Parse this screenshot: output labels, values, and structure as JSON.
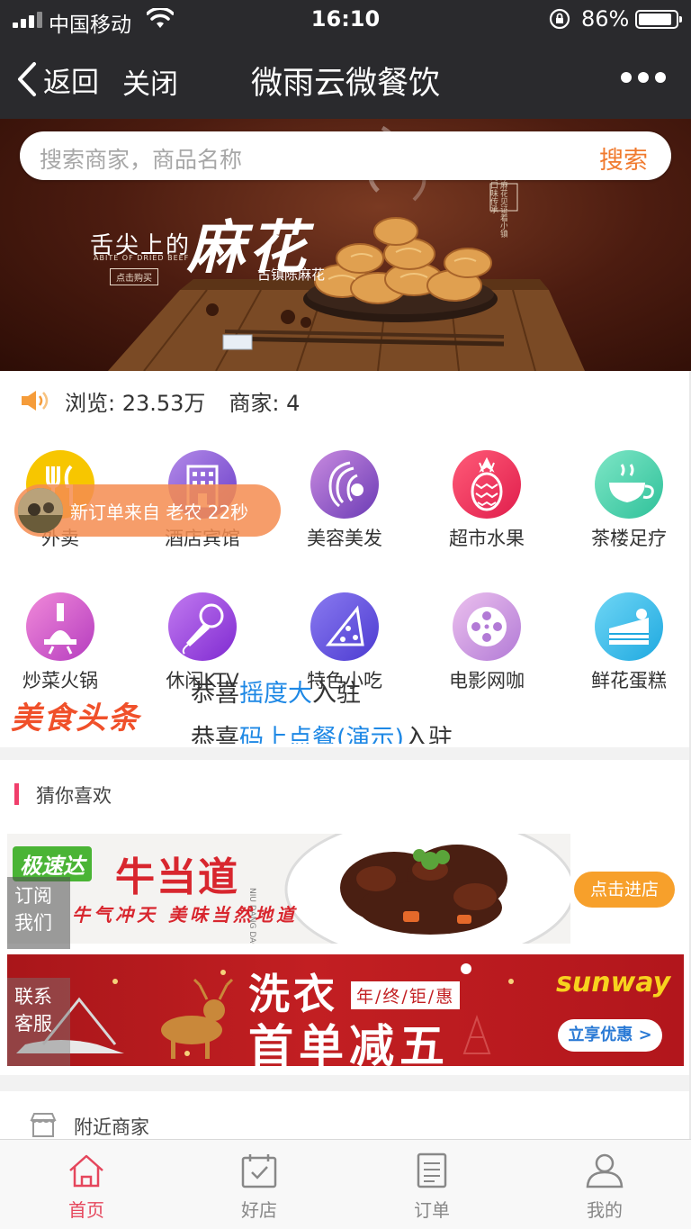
{
  "status_bar": {
    "carrier": "中国移动",
    "time": "16:10",
    "battery": "86%"
  },
  "nav": {
    "back_label": "返回",
    "close_label": "关闭",
    "title": "微雨云微餐饮"
  },
  "search": {
    "placeholder": "搜索商家，商品名称",
    "button": "搜索"
  },
  "banner": {
    "slogan": "舌尖上的",
    "main": "麻花",
    "sub": "古镇陈麻花",
    "english": "ABITE OF DRIED BEEF",
    "buy": "点击购买",
    "poem": "陈麻花见证着小镇的口味传承"
  },
  "stats": {
    "views": "浏览: 23.53万",
    "merchants": "商家: 4"
  },
  "categories": [
    {
      "label": "外卖",
      "icon": "fork-knife-icon",
      "color": "#f7c600"
    },
    {
      "label": "酒店宾馆",
      "icon": "hotel-building-icon",
      "color": "#8a5fd6"
    },
    {
      "label": "美容美发",
      "icon": "woman-hair-icon",
      "color": "#9b59c9"
    },
    {
      "label": "超市水果",
      "icon": "pineapple-icon",
      "color": "#f0305a"
    },
    {
      "label": "茶楼足疗",
      "icon": "tea-cup-icon",
      "color": "#3fd0a6"
    },
    {
      "label": "炒菜火锅",
      "icon": "hotpot-icon",
      "color": "#d64fc7"
    },
    {
      "label": "休闲KTV",
      "icon": "microphone-icon",
      "color": "#9d48e0"
    },
    {
      "label": "特色小吃",
      "icon": "pizza-icon",
      "color": "#6a55e0"
    },
    {
      "label": "电影网咖",
      "icon": "film-reel-icon",
      "color": "#c77ad8"
    },
    {
      "label": "鲜花蛋糕",
      "icon": "cake-icon",
      "color": "#2fb8e6"
    }
  ],
  "toast": {
    "text": "新订单来自 老农  22秒"
  },
  "headline": {
    "logo": "美食头条",
    "line1_prefix": "恭喜",
    "line1_name": "摇度大",
    "line1_suffix": "入驻",
    "line2_prefix": "恭喜",
    "line2_name": "码上点餐(演示)",
    "line2_suffix": "入驻"
  },
  "recommend": {
    "title": "猜你喜欢"
  },
  "ad1": {
    "brand": "极速达",
    "title": "牛当道",
    "pinyin": "NIU DANG DAO",
    "slogan": "牛气冲天 美味当然地道",
    "cta": "点击进店"
  },
  "ad2": {
    "line1": "洗衣",
    "tag": "年/终/钜/惠",
    "line2": "首单减五",
    "brand": "sunway",
    "button": "立享优惠 >"
  },
  "side": {
    "subscribe_1": "订阅",
    "subscribe_2": "我们",
    "service_1": "联系",
    "service_2": "客服"
  },
  "nearby": {
    "label": "附近商家"
  },
  "tabbar": [
    {
      "label": "首页",
      "icon": "home-icon",
      "active": true
    },
    {
      "label": "好店",
      "icon": "calendar-check-icon",
      "active": false
    },
    {
      "label": "订单",
      "icon": "order-list-icon",
      "active": false
    },
    {
      "label": "我的",
      "icon": "user-icon",
      "active": false
    }
  ],
  "colors": {
    "accent": "#e5465c",
    "search_button": "#f07a2e",
    "headline_link": "#1e88e5",
    "header_bg": "#2a2a2d"
  }
}
